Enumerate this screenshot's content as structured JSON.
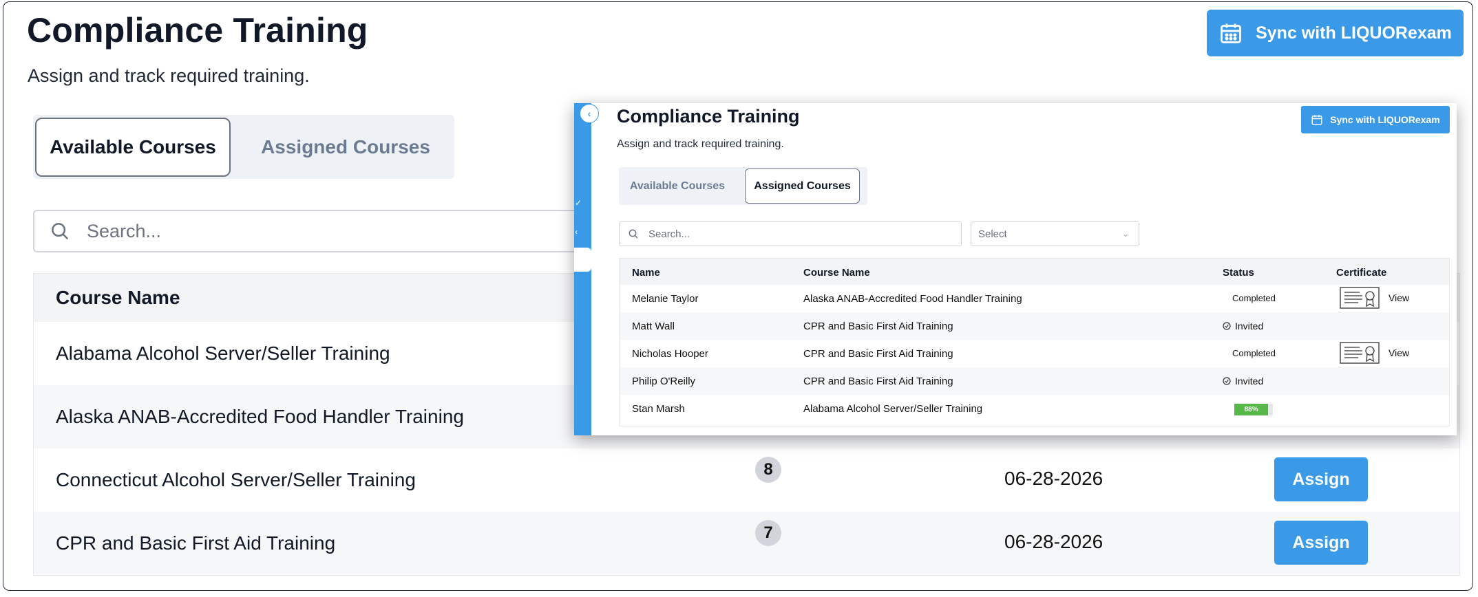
{
  "page": {
    "title": "Compliance Training",
    "subtitle": "Assign and track required training.",
    "sync_label": "Sync with LIQUORexam",
    "tabs": {
      "available": "Available Courses",
      "assigned": "Assigned Courses"
    },
    "search_placeholder": "Search...",
    "table": {
      "header": "Course Name",
      "rows": [
        {
          "course": "Alabama Alcohol Server/Seller Training",
          "count": "",
          "date": "",
          "action": ""
        },
        {
          "course": "Alaska ANAB-Accredited Food Handler Training",
          "count": "",
          "date": "",
          "action": ""
        },
        {
          "course": "Connecticut Alcohol Server/Seller Training",
          "count": "8",
          "date": "06-28-2026",
          "action": "Assign"
        },
        {
          "course": "CPR and Basic First Aid Training",
          "count": "7",
          "date": "06-28-2026",
          "action": "Assign"
        }
      ]
    }
  },
  "overlay": {
    "title": "Compliance Training",
    "subtitle": "Assign and track required training.",
    "sync_label": "Sync with LIQUORexam",
    "tabs": {
      "available": "Available Courses",
      "assigned": "Assigned Courses"
    },
    "search_placeholder": "Search...",
    "select_value": "Select",
    "table": {
      "headers": {
        "name": "Name",
        "course": "Course Name",
        "status": "Status",
        "certificate": "Certificate"
      },
      "rows": [
        {
          "name": "Melanie Taylor",
          "course": "Alaska ANAB-Accredited Food Handler Training",
          "status": "Completed",
          "certificate": "View"
        },
        {
          "name": "Matt Wall",
          "course": "CPR and Basic First Aid Training",
          "status": "Invited",
          "certificate": ""
        },
        {
          "name": "Nicholas Hooper",
          "course": "CPR and Basic First Aid Training",
          "status": "Completed",
          "certificate": "View"
        },
        {
          "name": "Philip O'Reilly",
          "course": "CPR and Basic First Aid Training",
          "status": "Invited",
          "certificate": ""
        },
        {
          "name": "Stan Marsh",
          "course": "Alabama Alcohol Server/Seller Training",
          "progress_label": "88%",
          "progress": 0.88,
          "certificate": ""
        }
      ]
    }
  },
  "colors": {
    "accent": "#3b9ae8",
    "progress": "#55b849",
    "muted_tab": "#6b7b91"
  },
  "icons": {
    "sync": "calendar-icon",
    "search": "search-icon",
    "collapse": "chevron-left-icon",
    "select": "chevron-down-icon",
    "invited": "check-circle-icon",
    "certificate": "certificate-icon"
  }
}
